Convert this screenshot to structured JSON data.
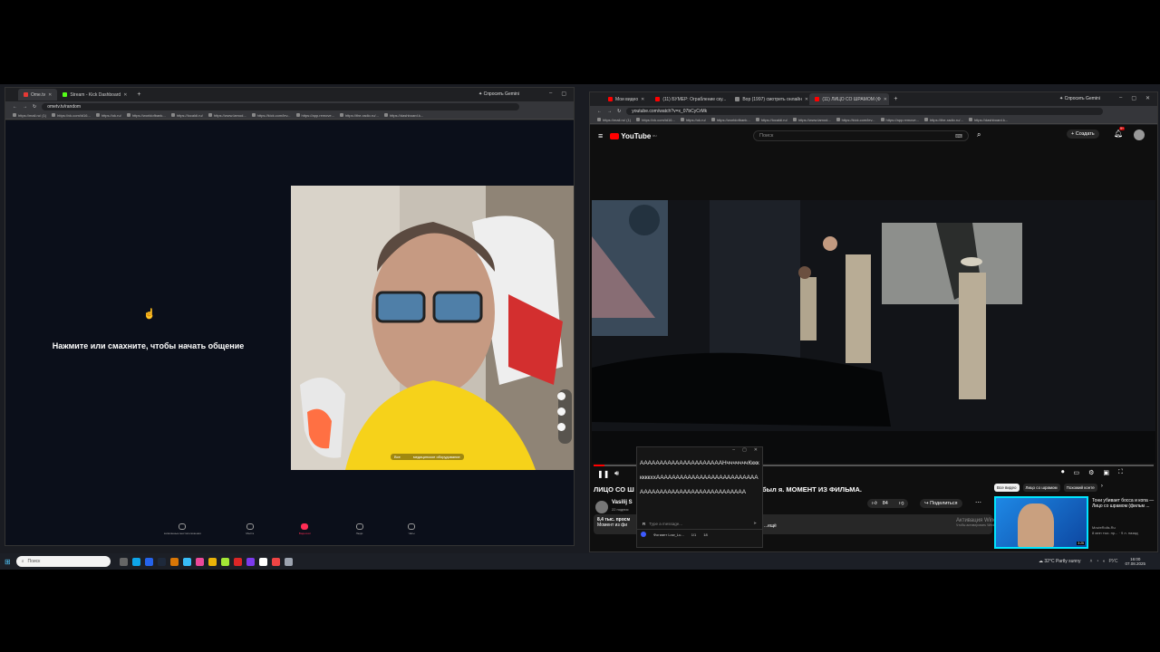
{
  "left_window": {
    "tabs": [
      {
        "label": "Ome.tv",
        "color": "#e53935"
      },
      {
        "label": "Stream - Kick Dashboard",
        "color": "#53fc18"
      }
    ],
    "gemini_label": "Спросить Gemini",
    "url": "ometv.tv/random",
    "bookmarks": [
      "https://mail.ru/ (1)",
      "https://vk.com/id16...",
      "https://ok.ru/",
      "https://worldofbank...",
      "https://localdi.ru/",
      "https://www.lamod...",
      "https://kick.com/lev...",
      "https://app.remove...",
      "https://the-radio.ru/...",
      "https://dashboard.k..."
    ],
    "cta_text": "Нажмите или смахните, чтобы начать общение",
    "webcam_caption_left": "Все",
    "webcam_caption_right": "медицинское оборудование",
    "nav": [
      {
        "label": "записанные местоположения",
        "active": false
      },
      {
        "label": "Места",
        "active": false
      },
      {
        "label": "Видеочат",
        "active": true
      },
      {
        "label": "Люди",
        "active": false
      },
      {
        "label": "Чаты",
        "active": false
      }
    ]
  },
  "right_window": {
    "tabs": [
      {
        "label": "Мои видео",
        "color": "#ff0000"
      },
      {
        "label": "(11) БУМЕР: Ограбление ску...",
        "color": "#ff0000"
      },
      {
        "label": "Вор (1997) смотреть онлайн",
        "color": "#888888"
      },
      {
        "label": "(11) ЛИЦО СО ШРАМОМ (Ф",
        "color": "#ff0000"
      }
    ],
    "gemini_label": "Спросить Gemini",
    "url": "youtube.com/watch?v=x_07bCyCrMk",
    "bookmarks": [
      "https://mail.ru/ (1)",
      "https://vk.com/id16...",
      "https://ok.ru/",
      "https://worldofbank...",
      "https://localdi.ru/",
      "https://www.lamod...",
      "https://kick.com/lev...",
      "https://app.remove...",
      "https://the-radio.ru/...",
      "https://dashboard.k..."
    ],
    "yt_logo": "YouTube",
    "yt_country": "RU",
    "search_placeholder": "Поиск",
    "create_label": "Создать",
    "notif_count": "9+",
    "video_title_left": "ЛИЦО СО Ш",
    "video_title_right": "был я. МОМЕНТ ИЗ ФИЛЬМА.",
    "channel": "Vasilij S",
    "subs": "22 подпис",
    "likes": "84",
    "share_label": "Поделиться",
    "views_line": "8,4 тыс. просм",
    "desc_line": "Момент из фи",
    "desc_more": "...ещё",
    "chips": [
      "Все видео",
      "Лицо со шрамом",
      "Похожий конте"
    ],
    "rec_title": "Тони убивает босса и копа — Лицо со шрамом (фильм ...",
    "rec_channel": "MovieRolls.Ru",
    "rec_meta": "8 млн тыс. пр... · 9 л. назад",
    "rec_duration": "3:25",
    "activation_title": "Активация Windows",
    "activation_sub": "Чтобы активировать Windows...",
    "chat_text": "AAAAAAAAAAAAAAAAAAAAАНчччччччКкккккккххAAAAAAAAAAAAAAAAAAAAAAAAAAAAAAAAAAAAAAAAAAAAAAAAAAAAA",
    "chat_placeholder": "Type a message...",
    "chat_footer_name": "Фогиант Low_Lu...",
    "chat_footer_a": "1/1",
    "chat_footer_b": "18"
  },
  "taskbar": {
    "search_placeholder": "Поиск",
    "weather": "32°C  Partly sunny",
    "lang": "РУС",
    "time": "16:00",
    "date": "07.08.2025"
  }
}
